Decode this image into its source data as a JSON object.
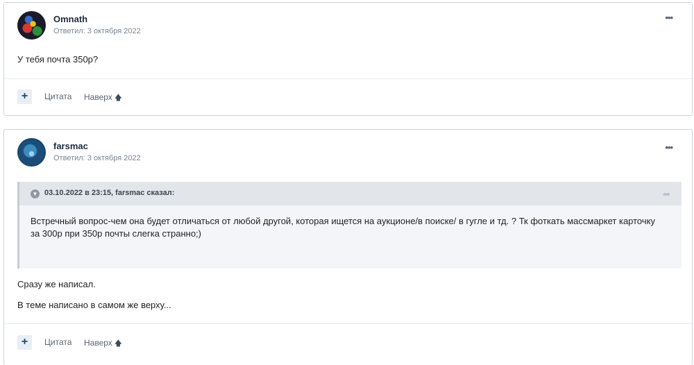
{
  "posts": [
    {
      "author": "Omnath",
      "meta": "Ответил: 3 октября 2022",
      "more": "•••",
      "lines": [
        "У тебя почта 350р?"
      ],
      "actions": {
        "plus": "+",
        "quote": "Цитата",
        "up": "Наверх",
        "up_icon": "arrow-up-icon"
      }
    },
    {
      "author": "farsmac",
      "meta": "Ответил: 3 октября 2022",
      "more": "•••",
      "quote": {
        "cite": "03.10.2022 в 23:15, farsmac сказал:",
        "body": "Встречный вопрос-чем она будет отличаться от любой другой, которая ищется на аукционе/в поиске/ в гугле и тд. ? Тк фоткать массмаркет карточку за 300р при 350р почты слегка странно;)"
      },
      "lines": [
        "Сразу же написал.",
        "В теме написано в самом же верху..."
      ],
      "actions": {
        "plus": "+",
        "quote": "Цитата",
        "up": "Наверх",
        "up_icon": "arrow-up-icon"
      }
    }
  ]
}
